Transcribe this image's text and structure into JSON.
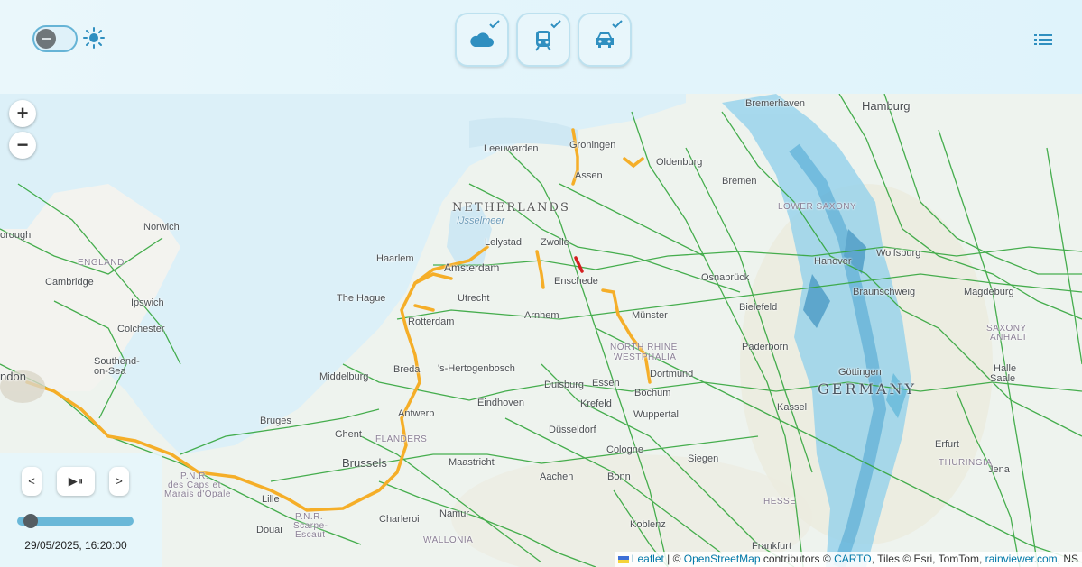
{
  "header": {
    "theme_toggle": {
      "state": "dark-off",
      "icon": "sun-icon"
    },
    "filters": [
      {
        "name": "weather",
        "icon": "cloud-icon",
        "checked": true
      },
      {
        "name": "train",
        "icon": "train-icon",
        "checked": true
      },
      {
        "name": "car",
        "icon": "car-icon",
        "checked": true
      }
    ],
    "menu_icon": "list-icon"
  },
  "map": {
    "zoom_in": "+",
    "zoom_out": "−",
    "countries": {
      "netherlands": "NETHERLANDS",
      "germany": "GERMANY"
    },
    "regions": {
      "england": "ENGLAND",
      "lower_saxony": "LOWER SAXONY",
      "nrw_1": "NORTH RHINE",
      "nrw_2": "WESTPHALIA",
      "saxony_anhalt_1": "SAXONY",
      "saxony_anhalt_2": "ANHALT",
      "flanders": "FLANDERS",
      "wallonia": "WALLONIA",
      "hesse": "HESSE",
      "thuringia": "THURINGIA"
    },
    "water": {
      "ijsselmeer": "IJsselmeer"
    },
    "cities": {
      "hamburg": "Hamburg",
      "bremerhaven": "Bremerhaven",
      "oldenburg": "Oldenburg",
      "bremen": "Bremen",
      "groningen": "Groningen",
      "leeuwarden": "Leeuwarden",
      "assen": "Assen",
      "lelystad": "Lelystad",
      "zwolle": "Zwolle",
      "haarlem": "Haarlem",
      "amsterdam": "Amsterdam",
      "enschede": "Enschede",
      "osnabruck": "Osnabrück",
      "hannover": "Hanover",
      "wolfsburg": "Wolfsburg",
      "braunschweig": "Braunschweig",
      "magdeburg": "Magdeburg",
      "the_hague": "The Hague",
      "utrecht": "Utrecht",
      "rotterdam": "Rotterdam",
      "arnhem": "Arnhem",
      "munster": "Münster",
      "bielefeld": "Bielefeld",
      "norwich": "Norwich",
      "cambridge": "Cambridge",
      "ipswich": "Ipswich",
      "colchester": "Colchester",
      "southend_1": "Southend-",
      "southend_2": "on-Sea",
      "london": "ndon",
      "orough": "orough",
      "middelburg": "Middelburg",
      "breda": "Breda",
      "hertogenbosch": "'s-Hertogenbosch",
      "duisburg": "Duisburg",
      "essen": "Essen",
      "dortmund": "Dortmund",
      "paderborn": "Paderborn",
      "gottingen": "Göttingen",
      "halle": "Halle",
      "saale": "Saale",
      "bochum": "Bochum",
      "krefeld": "Krefeld",
      "wuppertal": "Wuppertal",
      "eindhoven": "Eindhoven",
      "antwerp": "Antwerp",
      "kassel": "Kassel",
      "bruges": "Bruges",
      "ghent": "Ghent",
      "dusseldorf": "Düsseldorf",
      "brussels": "Brussels",
      "maastricht": "Maastricht",
      "cologne": "Cologne",
      "siegen": "Siegen",
      "aachen": "Aachen",
      "bonn": "Bonn",
      "erfurt": "Erfurt",
      "jena": "Jena",
      "lille": "Lille",
      "namur": "Namur",
      "charleroi": "Charleroi",
      "douai": "Douai",
      "koblenz": "Koblenz",
      "frankfurt": "Frankfurt",
      "pnr_1": "P.N.R.",
      "pnr_2": "des Caps et",
      "pnr_3": "Marais d'Opale",
      "pnr_4": "P.N.R.",
      "pnr_5": "Scarpe-",
      "pnr_6": "Escaut"
    }
  },
  "playback": {
    "prev_label": "<",
    "next_label": ">",
    "play_pause_label": "▶⏸",
    "progress": 0.12,
    "timestamp": "29/05/2025, 16:20:00"
  },
  "attribution": {
    "leaflet": "Leaflet",
    "sep": " | © ",
    "osm": "OpenStreetMap",
    "contributors": " contributors © ",
    "carto": "CARTO",
    "tiles": ", Tiles © Esri, TomTom, ",
    "rainviewer": "rainviewer.com",
    "ns": ", NS"
  },
  "colors": {
    "accent": "#2f8fc0",
    "rail": "#33a63c",
    "disruption": "#f5ae28",
    "alert": "#d42020",
    "rain": "#4aa9d8"
  }
}
